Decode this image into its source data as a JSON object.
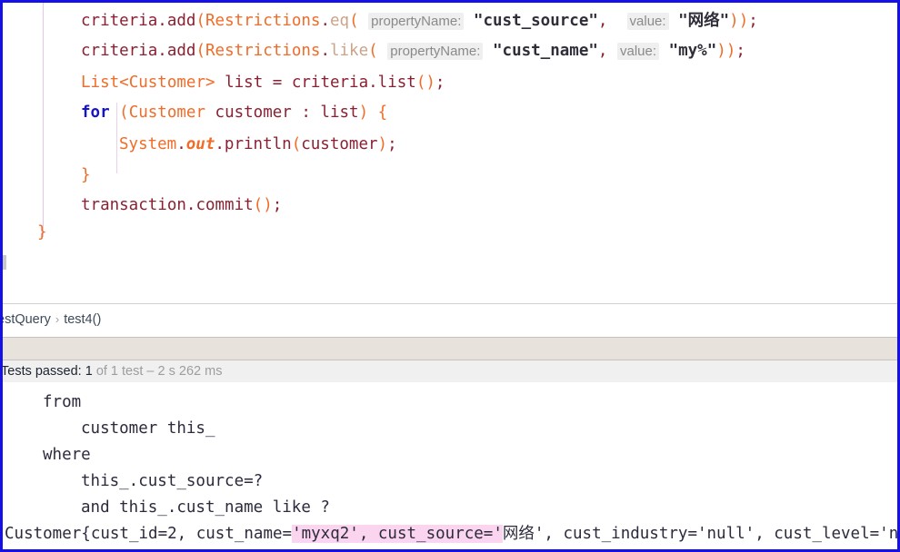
{
  "window": {
    "frame_color": "#1510e8",
    "background": "#ffffff"
  },
  "editor": {
    "name": "java-code-editor",
    "indent_guide_color": "#e6c5e6",
    "syntax_colors": {
      "keyword": "#1515c7",
      "class": "#f06c28",
      "method_call": "#c9a48a",
      "identifier": "#8a2133",
      "string": "#2f2f3a",
      "parameter_hint_bg": "#efefef",
      "parameter_hint_fg": "#8a8a8a"
    },
    "lines": [
      {
        "id": "line-criteria-add-eq",
        "tokens": [
          {
            "t": "criteria",
            "c": "plain"
          },
          {
            "t": ".",
            "c": "plain"
          },
          {
            "t": "add",
            "c": "plain"
          },
          {
            "t": "(",
            "c": "punc"
          },
          {
            "t": "Restrictions",
            "c": "cls"
          },
          {
            "t": ".",
            "c": "plain"
          },
          {
            "t": "eq",
            "c": "mtd"
          },
          {
            "t": "(",
            "c": "punc"
          },
          {
            "t": " ",
            "c": "plain"
          },
          {
            "t": "propertyName:",
            "c": "hint"
          },
          {
            "t": " ",
            "c": "plain"
          },
          {
            "t": "\"cust_source\"",
            "c": "str"
          },
          {
            "t": ",",
            "c": "plain"
          },
          {
            "t": "  ",
            "c": "plain"
          },
          {
            "t": "value:",
            "c": "hint"
          },
          {
            "t": " ",
            "c": "plain"
          },
          {
            "t": "\"网络\"",
            "c": "str"
          },
          {
            "t": ")",
            "c": "punc"
          },
          {
            "t": ")",
            "c": "punc"
          },
          {
            "t": ";",
            "c": "plain"
          }
        ]
      },
      {
        "id": "line-criteria-add-like",
        "tokens": [
          {
            "t": "criteria",
            "c": "plain"
          },
          {
            "t": ".",
            "c": "plain"
          },
          {
            "t": "add",
            "c": "plain"
          },
          {
            "t": "(",
            "c": "punc"
          },
          {
            "t": "Restrictions",
            "c": "cls"
          },
          {
            "t": ".",
            "c": "plain"
          },
          {
            "t": "like",
            "c": "mtd"
          },
          {
            "t": "(",
            "c": "punc"
          },
          {
            "t": " ",
            "c": "plain"
          },
          {
            "t": "propertyName:",
            "c": "hint"
          },
          {
            "t": " ",
            "c": "plain"
          },
          {
            "t": "\"cust_name\"",
            "c": "str"
          },
          {
            "t": ",",
            "c": "plain"
          },
          {
            "t": " ",
            "c": "plain"
          },
          {
            "t": "value:",
            "c": "hint"
          },
          {
            "t": " ",
            "c": "plain"
          },
          {
            "t": "\"my%\"",
            "c": "str"
          },
          {
            "t": ")",
            "c": "punc"
          },
          {
            "t": ")",
            "c": "punc"
          },
          {
            "t": ";",
            "c": "plain"
          }
        ]
      },
      {
        "id": "line-list-declaration",
        "tokens": [
          {
            "t": "List",
            "c": "cls"
          },
          {
            "t": "<",
            "c": "cls"
          },
          {
            "t": "Customer",
            "c": "cls"
          },
          {
            "t": ">",
            "c": "cls"
          },
          {
            "t": " list = criteria",
            "c": "plain"
          },
          {
            "t": ".",
            "c": "plain"
          },
          {
            "t": "list",
            "c": "plain"
          },
          {
            "t": "(",
            "c": "punc"
          },
          {
            "t": ")",
            "c": "punc"
          },
          {
            "t": ";",
            "c": "plain"
          }
        ]
      },
      {
        "id": "line-for-loop",
        "tokens": [
          {
            "t": "for",
            "c": "kw"
          },
          {
            "t": " ",
            "c": "plain"
          },
          {
            "t": "(",
            "c": "punc"
          },
          {
            "t": "Customer",
            "c": "cls"
          },
          {
            "t": " customer : list",
            "c": "plain"
          },
          {
            "t": ")",
            "c": "punc"
          },
          {
            "t": " ",
            "c": "plain"
          },
          {
            "t": "{",
            "c": "punc"
          }
        ]
      },
      {
        "id": "line-println",
        "tokens": [
          {
            "t": "System",
            "c": "statcls"
          },
          {
            "t": ".",
            "c": "plain"
          },
          {
            "t": "out",
            "c": "statfld"
          },
          {
            "t": ".",
            "c": "plain"
          },
          {
            "t": "println",
            "c": "plain"
          },
          {
            "t": "(",
            "c": "punc"
          },
          {
            "t": "customer",
            "c": "plain"
          },
          {
            "t": ")",
            "c": "punc"
          },
          {
            "t": ";",
            "c": "plain"
          }
        ]
      },
      {
        "id": "line-close-for",
        "tokens": [
          {
            "t": "}",
            "c": "punc"
          }
        ]
      },
      {
        "id": "line-transaction-commit",
        "tokens": [
          {
            "t": "transaction",
            "c": "plain"
          },
          {
            "t": ".",
            "c": "plain"
          },
          {
            "t": "commit",
            "c": "plain"
          },
          {
            "t": "(",
            "c": "punc"
          },
          {
            "t": ")",
            "c": "punc"
          },
          {
            "t": ";",
            "c": "plain"
          }
        ]
      },
      {
        "id": "line-close-method",
        "tokens": [
          {
            "t": "}",
            "c": "punc"
          }
        ]
      }
    ]
  },
  "run_panel": {
    "breadcrumb": {
      "name": "test-breadcrumb",
      "class_part": "estQuery",
      "separator": "›",
      "method_part": "test4()"
    },
    "toolbar": {
      "name": "run-toolbar",
      "background": "#e8e2dd"
    },
    "status": {
      "name": "test-status-bar",
      "label": "Tests passed:",
      "count": "1",
      "detail": "of 1 test – 2 s 262 ms",
      "background": "#f0f0f0"
    },
    "console": {
      "name": "run-console-output",
      "selection_color": "#fbd5ef",
      "lines": [
        {
          "id": "console-from",
          "indent": 4,
          "segments": [
            {
              "t": "from",
              "h": false
            }
          ]
        },
        {
          "id": "console-customer-alias",
          "indent": 8,
          "segments": [
            {
              "t": "customer this_",
              "h": false
            }
          ]
        },
        {
          "id": "console-where",
          "indent": 4,
          "segments": [
            {
              "t": "where",
              "h": false
            }
          ]
        },
        {
          "id": "console-cond-source",
          "indent": 8,
          "segments": [
            {
              "t": "this_.cust_source=?",
              "h": false
            }
          ]
        },
        {
          "id": "console-cond-name",
          "indent": 8,
          "segments": [
            {
              "t": "and this_.cust_name like ?",
              "h": false
            }
          ]
        },
        {
          "id": "console-customer-object",
          "indent": 0,
          "segments": [
            {
              "t": "Customer{cust_id=2, cust_name=",
              "h": false
            },
            {
              "t": "'myxq2', cust_source='",
              "h": true
            },
            {
              "t": "网络', cust_industry='null', cust_level='null',",
              "h": false
            }
          ]
        }
      ]
    }
  }
}
